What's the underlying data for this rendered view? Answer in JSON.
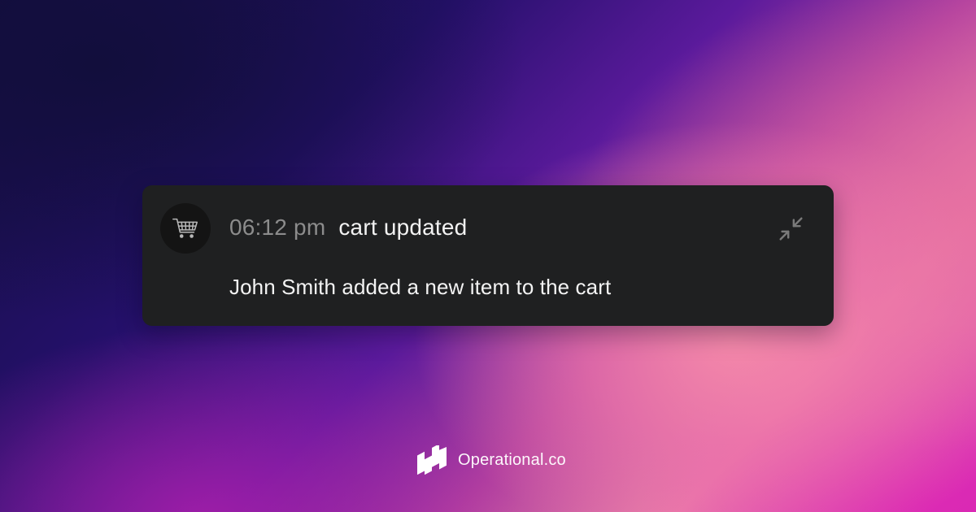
{
  "notification": {
    "time": "06:12 pm",
    "title": "cart updated",
    "message": "John Smith added a new item to the cart",
    "avatar_icon": "shopping-cart-icon",
    "collapse_icon": "minimize-arrows-icon"
  },
  "brand": {
    "name": "Operational.co",
    "logo_icon": "operational-logo-icon"
  },
  "colors": {
    "card_background": "#1f2021",
    "time_text": "#8c8c8c",
    "title_text": "#f2f2f2",
    "message_text": "#f3f3f3",
    "icon_gray": "#7a7a7a"
  }
}
